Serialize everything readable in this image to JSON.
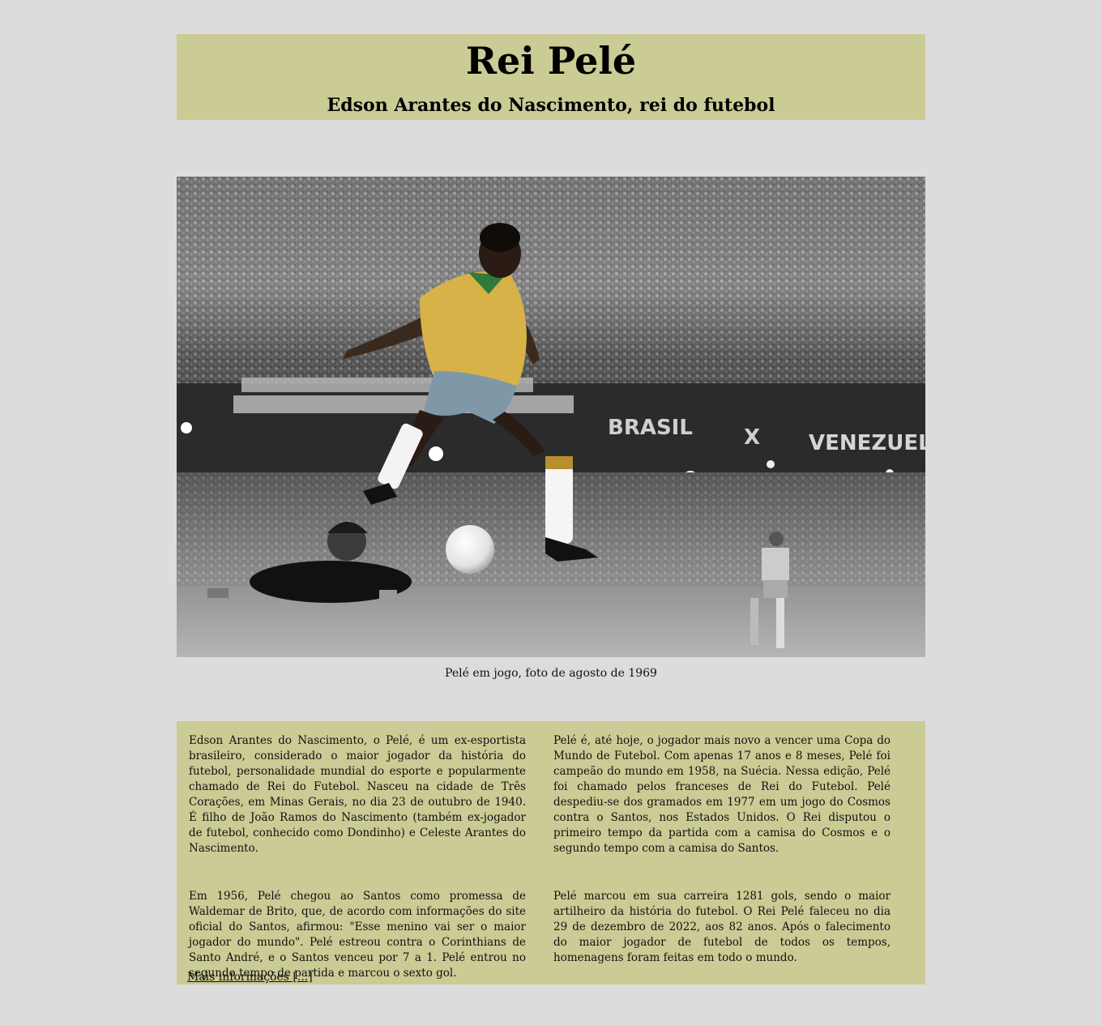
{
  "header": {
    "title": "Rei Pelé",
    "subtitle": "Edson Arantes do Nascimento, rei do futebol"
  },
  "photo": {
    "stadium_banner_left": "BRASIL",
    "stadium_banner_mid": "X",
    "stadium_banner_right": "VENEZUELA"
  },
  "caption": "Pelé em jogo, foto de agosto de 1969",
  "article": {
    "col_left": [
      "Edson Arantes do Nascimento, o Pelé, é um ex-esportista brasileiro, considerado o maior jogador da história do futebol, personalidade mundial do esporte e popularmente chamado de Rei do Futebol. Nasceu na cidade de Três Corações, em Minas Gerais, no dia 23 de outubro de 1940. É filho de João Ramos do Nascimento (também ex-jogador de futebol, conhecido como Dondinho) e Celeste Arantes do Nascimento.",
      "Em 1956, Pelé chegou ao Santos como promessa de Waldemar de Brito, que, de acordo com informações do site oficial do Santos, afirmou: \"Esse menino vai ser o maior jogador do mundo\". Pelé estreou contra o Corinthians de Santo André, e o Santos venceu por 7 a 1. Pelé entrou no segundo tempo de partida e marcou o sexto gol."
    ],
    "col_right": [
      "Pelé é, até hoje, o jogador mais novo a vencer uma Copa do Mundo de Futebol. Com apenas 17 anos e 8 meses, Pelé foi campeão do mundo em 1958, na Suécia. Nessa edição, Pelé foi chamado pelos franceses de Rei do Futebol. Pelé despediu-se dos gramados em 1977 em um jogo do Cosmos contra o Santos, nos Estados Unidos. O Rei disputou o primeiro tempo da partida com a camisa do Cosmos e o segundo tempo com a camisa do Santos.",
      "Pelé marcou em sua carreira 1281 gols, sendo o maior artilheiro da história do futebol. O Rei Pelé faleceu no dia 29 de dezembro de 2022, aos 82 anos. Após o falecimento do maior jogador de futebol de todos os tempos, homenagens foram feitas em todo o mundo."
    ],
    "more_link": "Mais informações [...]"
  }
}
